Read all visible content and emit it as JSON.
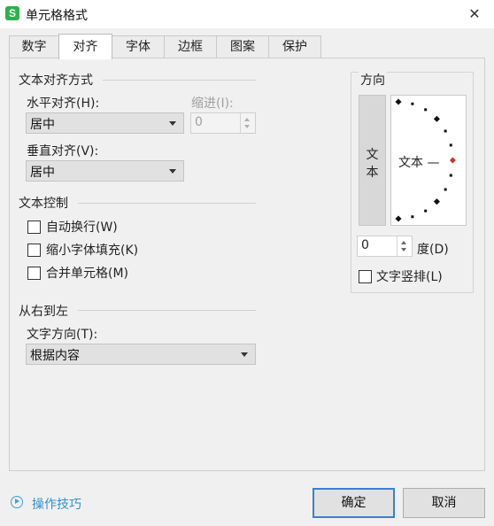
{
  "window": {
    "title": "单元格格式",
    "app_icon_letter": "S",
    "close_glyph": "✕"
  },
  "tabs": [
    {
      "label": "数字",
      "active": false
    },
    {
      "label": "对齐",
      "active": true
    },
    {
      "label": "字体",
      "active": false
    },
    {
      "label": "边框",
      "active": false
    },
    {
      "label": "图案",
      "active": false
    },
    {
      "label": "保护",
      "active": false
    }
  ],
  "alignment": {
    "section_title": "文本对齐方式",
    "horizontal": {
      "label": "水平对齐(H):",
      "value": "居中"
    },
    "indent": {
      "label": "缩进(I):",
      "value": "0",
      "disabled": true
    },
    "vertical": {
      "label": "垂直对齐(V):",
      "value": "居中"
    }
  },
  "text_control": {
    "section_title": "文本控制",
    "options": [
      {
        "label": "自动换行(W)",
        "checked": false
      },
      {
        "label": "缩小字体填充(K)",
        "checked": false
      },
      {
        "label": "合并单元格(M)",
        "checked": false
      }
    ]
  },
  "rtl": {
    "section_title": "从右到左",
    "direction": {
      "label": "文字方向(T):",
      "value": "根据内容"
    }
  },
  "orientation": {
    "title": "方向",
    "vertical_text": [
      "文",
      "本"
    ],
    "dial_text": "文本 —",
    "degrees_value": "0",
    "degrees_label": "度(D)",
    "stacked": {
      "label": "文字竖排(L)",
      "checked": false
    },
    "dot_color": "#111111",
    "marker_color": "#c0392b"
  },
  "footer": {
    "tips_label": "操作技巧",
    "ok_label": "确定",
    "cancel_label": "取消"
  }
}
